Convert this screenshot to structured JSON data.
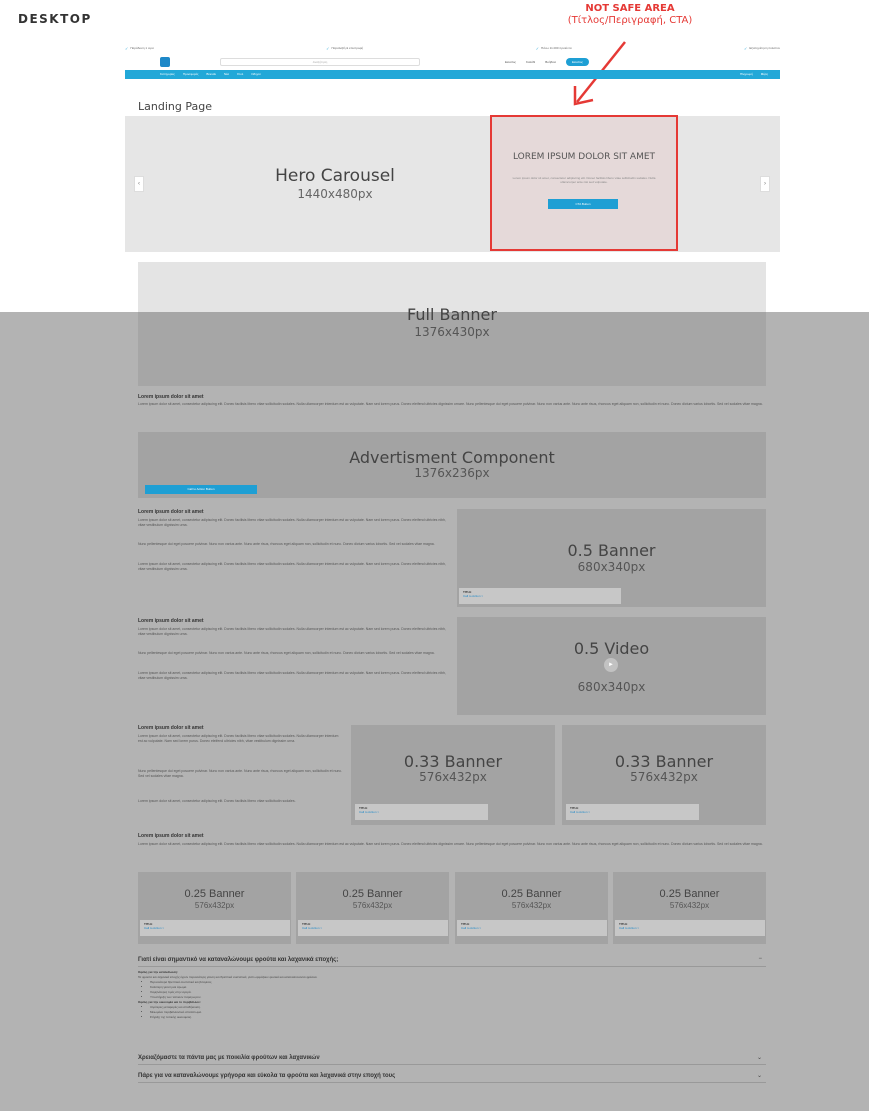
{
  "annotation": {
    "device_label": "DESKTOP",
    "not_safe_title": "NOT SAFE AREA",
    "not_safe_subtitle": "(Τίτλος/Περιγραφή, CTA)"
  },
  "header": {
    "usp": [
      "Παράδοση 1 ώρα",
      "Παραλαβή & επιστροφή",
      "Πάνω 11.000 προϊόντα",
      "Εξυπηρέτηση πελατών"
    ],
    "search_placeholder": "Αναζήτηση",
    "actions": [
      "Είσοδος",
      "Καλάθι",
      "Βοήθεια"
    ],
    "login_label": "Είσοδος",
    "nav_left": [
      "Κατηγορίες",
      "Προσφορές",
      "Brands",
      "Νέα",
      "Στυλ",
      "Οδηγοί"
    ],
    "nav_right": [
      "Πληρωμή",
      "Μέρη"
    ]
  },
  "page_title": "Landing Page",
  "hero": {
    "title": "Hero Carousel",
    "dims": "1440x480px",
    "prev_icon": "‹",
    "next_icon": "›",
    "headline": "LOREM IPSUM DOLOR SIT AMET",
    "body": "Lorem ipsum dolor sit amet, consectetur adipiscing elit. Donec facilisis libero vitae sollicitudin sodales. Nulla ullamcorper ante nisi sed vulputate.",
    "cta": "CTA Button"
  },
  "full_banner": {
    "title": "Full Banner",
    "dims": "1376x430px"
  },
  "text_block_1": {
    "title": "Lorem ipsum dolor sit amet",
    "text": "Lorem ipsum dolor sit amet, consectetur adipiscing elit. Donec facilisis libero vitae sollicitudin sodales. Nulla ullamcorper interdum est ac vulputate. Nam sed lorem purus. Donec eleifend ultricies dignissim ornare. Nunc pellentesque dui eget posuere pulvinar. Nunc non varius ante. Nunc ante risus, rhoncus eget aliquam non, sollicitudin et nunc. Donec dictum varius lobortis. Sed vel sodales vitae magna."
  },
  "advertisment": {
    "title": "Advertisment Component",
    "dims": "1376x236px",
    "button": "Call to Action Button"
  },
  "half_rows": [
    {
      "title": "Lorem ipsum dolor sit amet",
      "paras": [
        "Lorem ipsum dolor sit amet, consectetur adipiscing elit. Donec facilisis libero vitae sollicitudin sodales. Nulla ullamcorper interdum est ac vulputate. Nam sed lorem purus. Donec eleifend ultricies nibh, vitae vestibulum dignissim urna.",
        "Nunc pellentesque dui eget posuere pulvinar. Nunc non varius ante. Nunc ante risus, rhoncus eget aliquam non, sollicitudin et nunc. Donec dictum varius lobortis. Sed vel sodales vitae magna.",
        "Lorem ipsum dolor sit amet, consectetur adipiscing elit. Donec facilisis libero vitae sollicitudin sodales. Nulla ullamcorper interdum est ac vulputate. Nam sed lorem purus. Donec eleifend ultricies nibh, vitae vestibulum dignissim urna."
      ],
      "media_title": "0.5 Banner",
      "media_dims": "680x340px",
      "caption_title": "TITLE",
      "caption_link": "Call to Action >"
    },
    {
      "title": "Lorem ipsum dolor sit amet",
      "paras": [
        "Lorem ipsum dolor sit amet, consectetur adipiscing elit. Donec facilisis libero vitae sollicitudin sodales. Nulla ullamcorper interdum est ac vulputate. Nam sed lorem purus. Donec eleifend ultricies nibh, vitae vestibulum dignissim urna.",
        "Nunc pellentesque dui eget posuere pulvinar. Nunc non varius ante. Nunc ante risus, rhoncus eget aliquam non, sollicitudin et nunc. Donec dictum varius lobortis. Sed vel sodales vitae magna.",
        "Lorem ipsum dolor sit amet, consectetur adipiscing elit. Donec facilisis libero vitae sollicitudin sodales. Nulla ullamcorper interdum est ac vulputate. Nam sed lorem purus. Donec eleifend ultricies nibh, vitae vestibulum dignissim urna."
      ],
      "media_title": "0.5 Video",
      "media_dims": "680x340px"
    }
  ],
  "third_row": {
    "title": "Lorem ipsum dolor sit amet",
    "paras": [
      "Lorem ipsum dolor sit amet, consectetur adipiscing elit. Donec facilisis libero vitae sollicitudin sodales. Nulla ullamcorper interdum est ac vulputate. Nam sed lorem purus. Donec eleifend ultricies nibh, vitae vestibulum dignissim urna.",
      "Nunc pellentesque dui eget posuere pulvinar. Nunc non varius ante. Nunc ante risus, rhoncus eget aliquam non, sollicitudin et nunc. Sed vel sodales vitae magna.",
      "Lorem ipsum dolor sit amet, consectetur adipiscing elit. Donec facilisis libero vitae sollicitudin sodales."
    ],
    "cards": [
      {
        "title": "0.33 Banner",
        "dims": "576x432px",
        "caption_title": "TITLE",
        "caption_link": "Call to Action >"
      },
      {
        "title": "0.33 Banner",
        "dims": "576x432px",
        "caption_title": "TITLE",
        "caption_link": "Call to Action >"
      }
    ]
  },
  "text_block_2": {
    "title": "Lorem ipsum dolor sit amet",
    "text": "Lorem ipsum dolor sit amet, consectetur adipiscing elit. Donec facilisis libero vitae sollicitudin sodales. Nulla ullamcorper interdum est ac vulputate. Nam sed lorem purus. Donec eleifend ultricies dignissim ornare. Nunc pellentesque dui eget posuere pulvinar. Nunc non varius ante. Nunc ante risus, rhoncus eget aliquam non, sollicitudin et nunc. Donec dictum varius lobortis. Sed vel sodales vitae magna."
  },
  "quarter_cards": [
    {
      "title": "0.25 Banner",
      "dims": "576x432px",
      "caption_title": "TITLE",
      "caption_link": "Call to Action >"
    },
    {
      "title": "0.25 Banner",
      "dims": "576x432px",
      "caption_title": "TITLE",
      "caption_link": "Call to Action >"
    },
    {
      "title": "0.25 Banner",
      "dims": "576x432px",
      "caption_title": "TITLE",
      "caption_link": "Call to Action >"
    },
    {
      "title": "0.25 Banner",
      "dims": "576x432px",
      "caption_title": "TITLE",
      "caption_link": "Call to Action >"
    }
  ],
  "faq": {
    "q1": "Γιατί είναι σημαντικό να καταναλώνουμε φρούτα και λαχανικά εποχής;",
    "q1_icon": "−",
    "h1": "Οφέλη για την κατανάλωση:",
    "intro": "Τα φρούτα και λαχανικά εποχής έχουν περισσότερη γεύση και θρεπτικά συστατικά, γιατί ωριμάζουν φυσικά και καταναλώνονται φρέσκα.",
    "bullets": [
      "Περισσότερα θρεπτικά συστατικά και βιταμίνες.",
      "Καλύτερη γεύση και άρωμα.",
      "Χαμηλότερες τιμές στην αγορά.",
      "Υποστήριξη των τοπικών παραγωγών."
    ],
    "h2": "Οφέλη για την οικονομία και το περιβάλλον:",
    "bullets2": [
      "Λιγότερες μεταφορές και αποθήκευση.",
      "Μειωμένο περιβαλλοντικό αποτύπωμα.",
      "Στήριξη της τοπικής οικονομίας."
    ],
    "q2": "Χρειαζόμαστε τα πάντα μας με ποικιλία φρούτων και λαχανικών",
    "q3": "Πάρε για να καταναλώνουμε γρήγορα και εύκολα τα φρούτα και λαχανικά στην εποχή τους",
    "collapsed_icon": "⌄"
  }
}
